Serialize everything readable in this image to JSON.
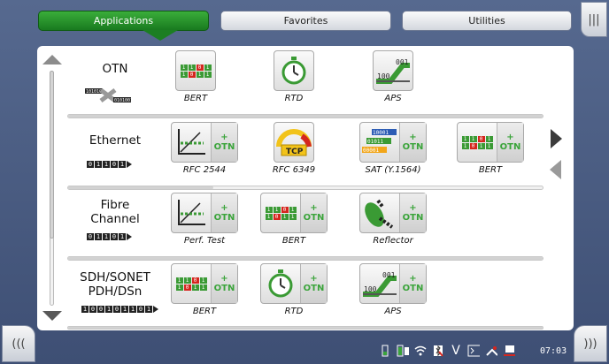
{
  "tabs": [
    {
      "label": "Applications",
      "active": true
    },
    {
      "label": "Favorites",
      "active": false
    },
    {
      "label": "Utilities",
      "active": false
    }
  ],
  "nav": {
    "menu_icon": "|||",
    "prev_icon": "(((",
    "next_icon": ")))"
  },
  "categories": [
    {
      "name_line1": "OTN",
      "name_line2": "",
      "code": "1010101",
      "apps": [
        {
          "label": "BERT",
          "icon": "bert-icon",
          "otn": false
        },
        {
          "label": "RTD",
          "icon": "stopwatch-icon",
          "otn": false
        },
        {
          "label": "APS",
          "icon": "aps-switch-icon",
          "otn": false
        }
      ]
    },
    {
      "name_line1": "Ethernet",
      "name_line2": "",
      "code": "01101",
      "apps": [
        {
          "label": "RFC 2544",
          "icon": "rfc2544-chart-icon",
          "otn": true
        },
        {
          "label": "RFC 6349",
          "icon": "tcp-gauge-icon",
          "otn": false
        },
        {
          "label": "SAT (Y.1564)",
          "icon": "sat-bits-icon",
          "otn": true
        },
        {
          "label": "BERT",
          "icon": "bert-icon",
          "otn": true
        }
      ]
    },
    {
      "name_line1": "Fibre",
      "name_line2": "Channel",
      "code": "01101",
      "apps": [
        {
          "label": "Perf. Test",
          "icon": "perf-chart-icon",
          "otn": true
        },
        {
          "label": "BERT",
          "icon": "bert-icon",
          "otn": true
        },
        {
          "label": "Reflector",
          "icon": "reflector-icon",
          "otn": true
        }
      ]
    },
    {
      "name_line1": "SDH/SONET",
      "name_line2": "PDH/DSn",
      "code": "100101101",
      "apps": [
        {
          "label": "BERT",
          "icon": "bert-icon",
          "otn": true
        },
        {
          "label": "RTD",
          "icon": "stopwatch-icon",
          "otn": true
        },
        {
          "label": "APS",
          "icon": "aps-switch-icon",
          "otn": true
        }
      ]
    }
  ],
  "otn_badge": {
    "plus": "+",
    "text": "OTN"
  },
  "icon_text": {
    "bert_bits": [
      "1",
      "1",
      "0",
      "1",
      "1",
      "0",
      "1",
      "1"
    ],
    "aps_top": "001",
    "aps_bottom": "100",
    "tcp": "TCP"
  },
  "status": {
    "time": "07:03",
    "v_label": "V"
  },
  "colors": {
    "accent_green": "#1c7e22",
    "otn_green": "#3aa43a",
    "frame_blue": "#4a5c82"
  }
}
